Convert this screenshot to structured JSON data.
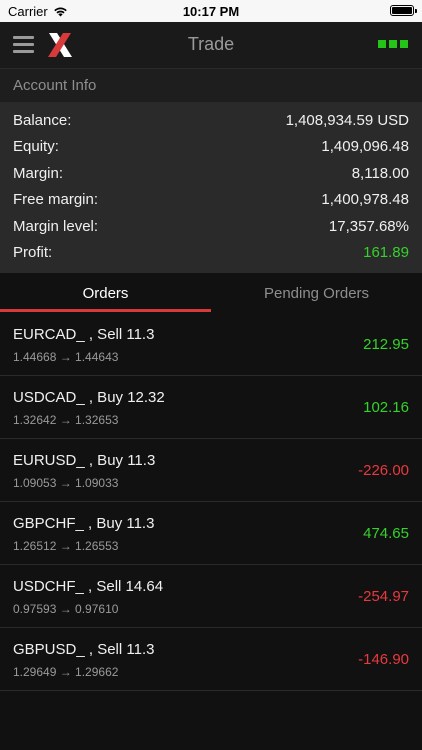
{
  "status_bar": {
    "carrier": "Carrier",
    "time": "10:17 PM"
  },
  "navbar": {
    "title": "Trade"
  },
  "account": {
    "header": "Account Info",
    "rows": [
      {
        "label": "Balance:",
        "value": "1,408,934.59 USD",
        "sign": "neutral"
      },
      {
        "label": "Equity:",
        "value": "1,409,096.48",
        "sign": "neutral"
      },
      {
        "label": "Margin:",
        "value": "8,118.00",
        "sign": "neutral"
      },
      {
        "label": "Free margin:",
        "value": "1,400,978.48",
        "sign": "neutral"
      },
      {
        "label": "Margin level:",
        "value": "17,357.68%",
        "sign": "neutral"
      },
      {
        "label": "Profit:",
        "value": "161.89",
        "sign": "positive"
      }
    ]
  },
  "tabs": [
    {
      "label": "Orders",
      "active": true
    },
    {
      "label": "Pending Orders",
      "active": false
    }
  ],
  "orders": [
    {
      "symbol": "EURCAD_ , Sell   11.3",
      "prices": "1.44668 → 1.44643",
      "profit": "212.95",
      "sign": "positive"
    },
    {
      "symbol": "USDCAD_ , Buy   12.32",
      "prices": "1.32642 → 1.32653",
      "profit": "102.16",
      "sign": "positive"
    },
    {
      "symbol": "EURUSD_ , Buy   11.3",
      "prices": "1.09053 → 1.09033",
      "profit": "-226.00",
      "sign": "negative"
    },
    {
      "symbol": "GBPCHF_ , Buy   11.3",
      "prices": "1.26512 → 1.26553",
      "profit": "474.65",
      "sign": "positive"
    },
    {
      "symbol": "USDCHF_ , Sell   14.64",
      "prices": "0.97593 → 0.97610",
      "profit": "-254.97",
      "sign": "negative"
    },
    {
      "symbol": "GBPUSD_ , Sell   11.3",
      "prices": "1.29649 → 1.29662",
      "profit": "-146.90",
      "sign": "negative"
    }
  ],
  "colors": {
    "positive": "#35d22b",
    "negative": "#e8393f",
    "accent": "#d63a3a",
    "signal": "#25c418"
  },
  "icons": [
    "wifi-icon",
    "battery-icon",
    "menu-icon",
    "brand-logo-icon",
    "connection-status-icon"
  ]
}
